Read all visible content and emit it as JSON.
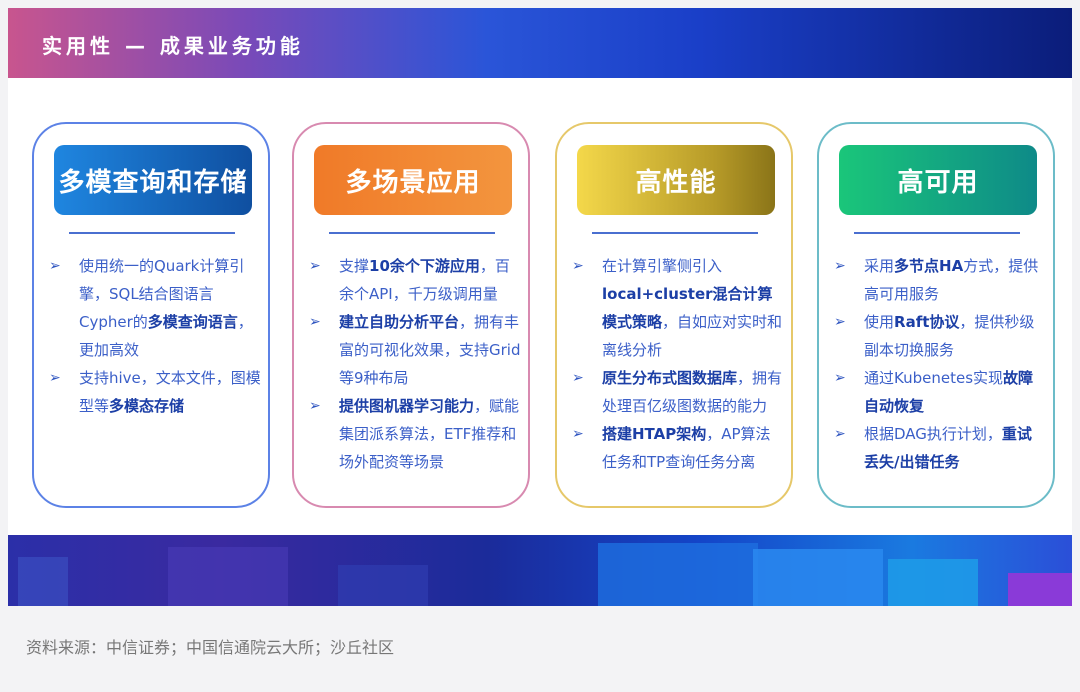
{
  "header": {
    "title": "实用性 — 成果业务功能"
  },
  "cards": [
    {
      "title": "多模查询和存储",
      "items": [
        {
          "segments": [
            {
              "t": "使用统一的Quark计算引擎，SQL结合图语言Cypher的",
              "b": false
            },
            {
              "t": "多模查询语言",
              "b": true
            },
            {
              "t": "，更加高效",
              "b": false
            }
          ]
        },
        {
          "segments": [
            {
              "t": "支持hive，文本文件，图模型等",
              "b": false
            },
            {
              "t": "多模态存储",
              "b": true
            }
          ]
        }
      ]
    },
    {
      "title": "多场景应用",
      "items": [
        {
          "segments": [
            {
              "t": "支撑",
              "b": false
            },
            {
              "t": "10余个下游应用",
              "b": true
            },
            {
              "t": "，百余个API，千万级调用量",
              "b": false
            }
          ]
        },
        {
          "segments": [
            {
              "t": "建立自助分析平台",
              "b": true
            },
            {
              "t": "，拥有丰富的可视化效果，支持Grid等9种布局",
              "b": false
            }
          ]
        },
        {
          "segments": [
            {
              "t": "提供图机器学习能力",
              "b": true
            },
            {
              "t": "，赋能集团派系算法，ETF推荐和场外配资等场景",
              "b": false
            }
          ]
        }
      ]
    },
    {
      "title": "高性能",
      "items": [
        {
          "segments": [
            {
              "t": "在计算引擎侧引入",
              "b": false
            },
            {
              "t": "local+cluster混合计算模式策略",
              "b": true
            },
            {
              "t": "，自如应对实时和离线分析",
              "b": false
            }
          ]
        },
        {
          "segments": [
            {
              "t": "原生分布式图数据库",
              "b": true
            },
            {
              "t": "，拥有处理百亿级图数据的能力",
              "b": false
            }
          ]
        },
        {
          "segments": [
            {
              "t": "搭建HTAP架构",
              "b": true
            },
            {
              "t": "，AP算法任务和TP查询任务分离",
              "b": false
            }
          ]
        }
      ]
    },
    {
      "title": "高可用",
      "items": [
        {
          "segments": [
            {
              "t": "采用",
              "b": false
            },
            {
              "t": "多节点HA",
              "b": true
            },
            {
              "t": "方式，提供高可用服务",
              "b": false
            }
          ]
        },
        {
          "segments": [
            {
              "t": "使用",
              "b": false
            },
            {
              "t": "Raft协议",
              "b": true
            },
            {
              "t": "，提供秒级副本切换服务",
              "b": false
            }
          ]
        },
        {
          "segments": [
            {
              "t": "通过Kubenetes实现",
              "b": false
            },
            {
              "t": "故障自动恢复",
              "b": true
            }
          ]
        },
        {
          "segments": [
            {
              "t": "根据DAG执行计划，",
              "b": false
            },
            {
              "t": "重试丢失/出错任务",
              "b": true
            }
          ]
        }
      ]
    }
  ],
  "bullet_glyph": "➢",
  "footer": {
    "source": "资料来源：中信证券；中国信通院云大所；沙丘社区"
  },
  "colors": {
    "text": "#3b5fc8",
    "text_bold": "#1c3fa6",
    "banner_start": "#c8558e",
    "banner_end": "#0b1d7a"
  }
}
